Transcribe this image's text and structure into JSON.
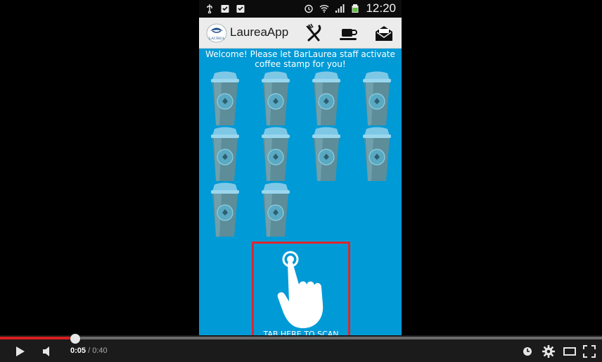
{
  "status_bar": {
    "left_icons": [
      "usb-icon",
      "clipboard-check-icon",
      "clipboard-check-icon"
    ],
    "right_icons": [
      "alarm-icon",
      "wifi-icon",
      "signal-icon",
      "battery-icon"
    ],
    "time": "12:20"
  },
  "action_bar": {
    "title": "LaureaApp",
    "logo_text": "LAUREA",
    "buttons": [
      {
        "name": "menu-button",
        "icon": "fork-knife-icon"
      },
      {
        "name": "coffee-button",
        "icon": "coffee-cup-icon"
      },
      {
        "name": "mail-button",
        "icon": "envelope-icon"
      }
    ]
  },
  "content": {
    "welcome": "Welcome! Please let BarLaurea staff activate coffee stamp for you!",
    "stamps": {
      "total": 10,
      "active": 0
    },
    "scan_label": "TAB HERE TO SCAN"
  },
  "player": {
    "current_time": "0:05",
    "duration": "/ 0:40",
    "progress": 0.125,
    "icons": [
      "play-icon",
      "volume-icon",
      "watch-later-icon",
      "settings-icon",
      "theater-mode-icon",
      "fullscreen-icon"
    ]
  },
  "colors": {
    "app_background": "#009ad6",
    "action_bar": "#ececec",
    "scan_border": "#e0262c",
    "progress_played": "#d6201f"
  }
}
